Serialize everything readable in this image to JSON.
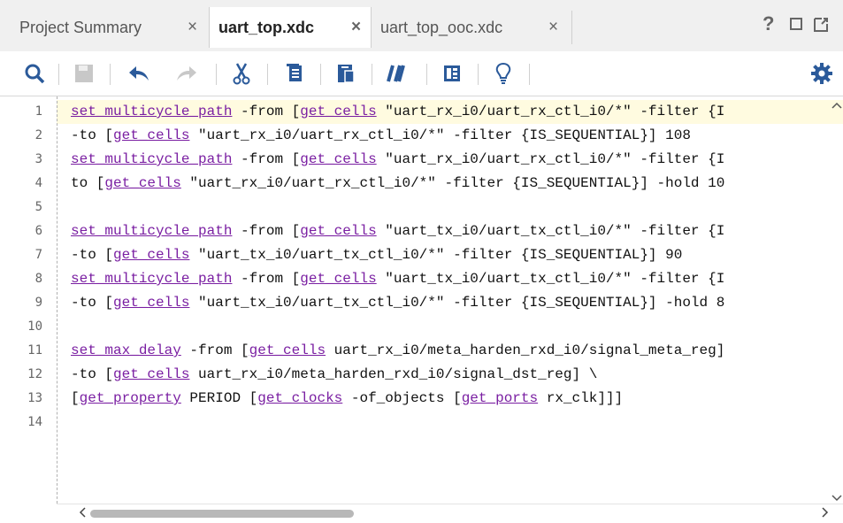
{
  "tabs": [
    {
      "label": "Project Summary",
      "close": "×",
      "active": false
    },
    {
      "label": "uart_top.xdc",
      "close": "×",
      "active": true
    },
    {
      "label": "uart_top_ooc.xdc",
      "close": "×",
      "active": false
    }
  ],
  "window_controls": {
    "help": "?"
  },
  "toolbar": {
    "icons": [
      "search-icon",
      "save-icon",
      "undo-icon",
      "redo-icon",
      "cut-icon",
      "copy-icon",
      "paste-icon",
      "comment-icon",
      "columns-icon",
      "lightbulb-icon",
      "settings-icon"
    ]
  },
  "colors": {
    "keyword": "#7a1fa2",
    "current_line": "#fffbe0",
    "accent": "#1f5fa8"
  },
  "editor": {
    "lines": [
      {
        "num": "1",
        "text": "set_multicycle_path -from [get_cells \"uart_rx_i0/uart_rx_ctl_i0/*\" -filter {I"
      },
      {
        "num": "2",
        "text": "-to [get_cells \"uart_rx_i0/uart_rx_ctl_i0/*\" -filter {IS_SEQUENTIAL}] 108"
      },
      {
        "num": "3",
        "text": "set_multicycle_path -from [get_cells \"uart_rx_i0/uart_rx_ctl_i0/*\" -filter {I"
      },
      {
        "num": "4",
        "text": "to [get_cells \"uart_rx_i0/uart_rx_ctl_i0/*\" -filter {IS_SEQUENTIAL}] -hold 10"
      },
      {
        "num": "5",
        "text": ""
      },
      {
        "num": "6",
        "text": "set_multicycle_path -from [get_cells \"uart_tx_i0/uart_tx_ctl_i0/*\" -filter {I"
      },
      {
        "num": "7",
        "text": "-to [get_cells \"uart_tx_i0/uart_tx_ctl_i0/*\" -filter {IS_SEQUENTIAL}] 90"
      },
      {
        "num": "8",
        "text": "set_multicycle_path -from [get_cells \"uart_tx_i0/uart_tx_ctl_i0/*\" -filter {I"
      },
      {
        "num": "9",
        "text": "-to [get_cells \"uart_tx_i0/uart_tx_ctl_i0/*\" -filter {IS_SEQUENTIAL}] -hold 8"
      },
      {
        "num": "10",
        "text": ""
      },
      {
        "num": "11",
        "text": "set_max_delay -from [get_cells uart_rx_i0/meta_harden_rxd_i0/signal_meta_reg]"
      },
      {
        "num": "12",
        "text": "-to [get_cells uart_rx_i0/meta_harden_rxd_i0/signal_dst_reg] \\"
      },
      {
        "num": "13",
        "text": "[get_property PERIOD [get_clocks -of_objects [get_ports rx_clk]]]"
      },
      {
        "num": "14",
        "text": ""
      }
    ]
  },
  "scroll": {
    "left_arrow": "<",
    "right_arrow": ">",
    "up_arrow": "^",
    "down_arrow": "v"
  }
}
